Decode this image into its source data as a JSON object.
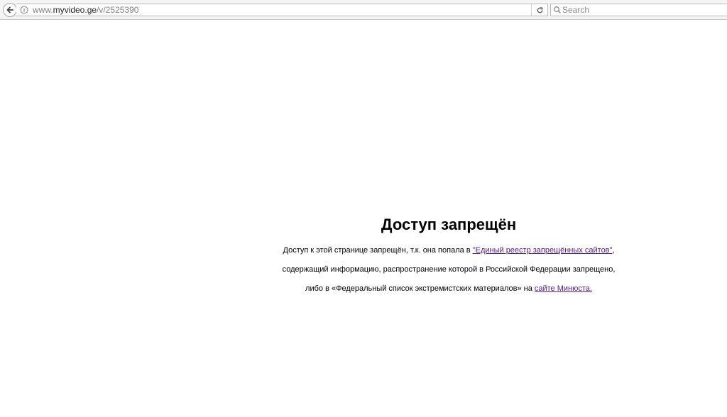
{
  "browser": {
    "url_prefix": "www.",
    "url_host": "myvideo.ge",
    "url_path": "/v/2525390",
    "search_placeholder": "Search"
  },
  "page": {
    "title": "Доступ запрещён",
    "line1_text": "Доступ к этой странице запрещён, т.к. она попала в ",
    "registry_link": "\"Единый реестр запрещённых сайтов\"",
    "line1_end": ",",
    "line2_text": "содержащий информацию, распространение которой в Российской Федерации запрещено,",
    "line3_text": "либо в «Федеральный список экстремистских материалов» на ",
    "minjust_link": "сайте Минюста."
  }
}
